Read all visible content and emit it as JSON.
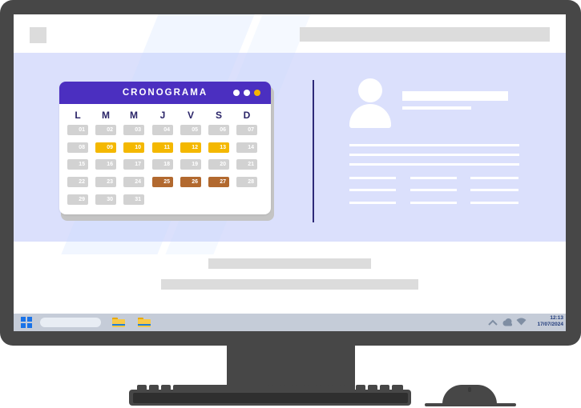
{
  "calendar": {
    "title": "CRONOGRAMA",
    "weekdays": [
      "L",
      "M",
      "M",
      "J",
      "V",
      "S",
      "D"
    ],
    "weeks": [
      [
        {
          "d": "01",
          "s": "n"
        },
        {
          "d": "02",
          "s": "n"
        },
        {
          "d": "03",
          "s": "n"
        },
        {
          "d": "04",
          "s": "n"
        },
        {
          "d": "05",
          "s": "n"
        },
        {
          "d": "06",
          "s": "n"
        },
        {
          "d": "07",
          "s": "n"
        }
      ],
      [
        {
          "d": "08",
          "s": "n"
        },
        {
          "d": "09",
          "s": "hl"
        },
        {
          "d": "10",
          "s": "hl"
        },
        {
          "d": "11",
          "s": "hl"
        },
        {
          "d": "12",
          "s": "hl"
        },
        {
          "d": "13",
          "s": "hl"
        },
        {
          "d": "14",
          "s": "n"
        }
      ],
      [
        {
          "d": "15",
          "s": "n"
        },
        {
          "d": "16",
          "s": "n"
        },
        {
          "d": "17",
          "s": "n"
        },
        {
          "d": "18",
          "s": "n"
        },
        {
          "d": "19",
          "s": "n"
        },
        {
          "d": "20",
          "s": "n"
        },
        {
          "d": "21",
          "s": "n"
        }
      ],
      [
        {
          "d": "22",
          "s": "n"
        },
        {
          "d": "23",
          "s": "n"
        },
        {
          "d": "24",
          "s": "n"
        },
        {
          "d": "25",
          "s": "br"
        },
        {
          "d": "26",
          "s": "br"
        },
        {
          "d": "27",
          "s": "br"
        },
        {
          "d": "28",
          "s": "n"
        }
      ],
      [
        {
          "d": "29",
          "s": "n"
        },
        {
          "d": "30",
          "s": "n"
        },
        {
          "d": "31",
          "s": "n"
        }
      ]
    ],
    "colors": {
      "header": "#4b2fc0",
      "highlight": "#f4b800",
      "event": "#b2692f",
      "default": "#d2d2d2"
    }
  },
  "taskbar": {
    "time": "12:13",
    "date": "17/07/2024",
    "icons": [
      "windows-start-icon",
      "folder-icon",
      "folder-icon",
      "chevron-up-icon",
      "cloud-icon",
      "wifi-icon"
    ]
  }
}
